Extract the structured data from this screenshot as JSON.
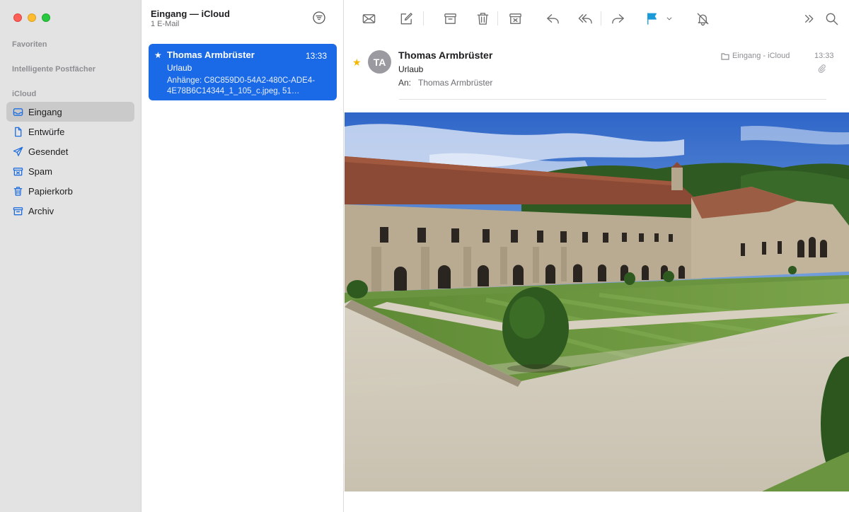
{
  "window": {
    "traffic_lights": [
      "close",
      "minimize",
      "zoom"
    ]
  },
  "sidebar": {
    "sections": {
      "favorites": "Favoriten",
      "smart": "Intelligente Postfächer",
      "icloud": "iCloud"
    },
    "items": [
      {
        "label": "Eingang",
        "icon": "inbox-icon",
        "selected": true
      },
      {
        "label": "Entwürfe",
        "icon": "draft-icon"
      },
      {
        "label": "Gesendet",
        "icon": "paperplane-icon"
      },
      {
        "label": "Spam",
        "icon": "junk-icon"
      },
      {
        "label": "Papierkorb",
        "icon": "trash-icon"
      },
      {
        "label": "Archiv",
        "icon": "archive-icon"
      }
    ],
    "accent_color": "#1f6fe0"
  },
  "list": {
    "title": "Eingang — iCloud",
    "count": "1 E-Mail",
    "messages": [
      {
        "sender": "Thomas Armbrüster",
        "time": "13:33",
        "subject": "Urlaub",
        "preview": "Anhänge: C8C859D0-54A2-480C-ADE4-4E78B6C14344_1_105_c.jpeg, 51…",
        "starred": true,
        "selected": true
      }
    ],
    "selection_color": "#1a69e6"
  },
  "toolbar": {
    "icons": [
      "envelope-icon",
      "compose-icon",
      "archive-icon",
      "trash-icon",
      "junk-icon",
      "reply-icon",
      "reply-all-icon",
      "forward-icon",
      "flag-icon",
      "flag-menu-chevron-icon",
      "mute-bell-icon",
      "overflow-chevron-icon",
      "search-icon"
    ],
    "flag_color": "#1a9bd7"
  },
  "message": {
    "avatar_initials": "TA",
    "from": "Thomas Armbrüster",
    "subject": "Urlaub",
    "to_label": "An:",
    "to": "Thomas Armbrüster",
    "mailbox": "Eingang - iCloud",
    "time": "13:33",
    "starred": true,
    "has_attachment": true,
    "attachment_image": "photo of an abbey courtyard with lawns, gravel paths and topiary"
  }
}
